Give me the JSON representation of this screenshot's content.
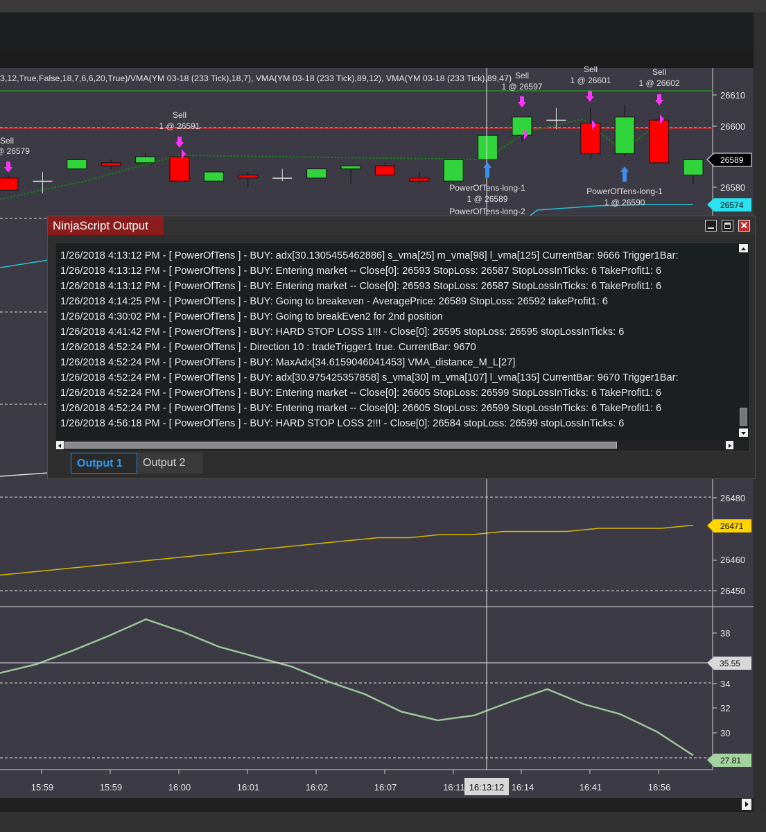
{
  "colors": {
    "chart_bg": "#3c3b45",
    "bull_candle": "#2fd53b",
    "bear_candle": "#ff0000",
    "sell_arrow": "#ff33ff",
    "buy_arrow": "#3b8ff0",
    "hline_red": "#cc2b2b",
    "hline_green": "#2a8a2a",
    "cyan": "#29c2d6",
    "gold": "#d9b800",
    "adx_line": "#9dc59a"
  },
  "chart_header": "3,12,True,False,18,7,6,6,20,True)/VMA(YM 03-18 (233 Tick),18,7), VMA(YM 03-18 (233 Tick),89,12), VMA(YM 03-18 (233 Tick),89,47)",
  "price_panel": {
    "ticks": [
      "26610",
      "26600",
      "26580"
    ],
    "last_price": "26589",
    "cyan_tag": "26574"
  },
  "vma_panel": {
    "ticks": [
      "26480",
      "26460",
      "26450"
    ],
    "gold_tag": "26471"
  },
  "adx_panel": {
    "ticks": [
      "38",
      "34",
      "32",
      "30"
    ],
    "crosshair_value": "35.55",
    "last_value": "27.81"
  },
  "time_axis": {
    "labels": [
      "15:59",
      "15:59",
      "16:00",
      "16:01",
      "16:02",
      "16:07",
      "16:11",
      "16:14",
      "16:41",
      "16:56"
    ],
    "crosshair_time": "16:13:12"
  },
  "annotations": [
    {
      "text": "Sell",
      "kind": "sell"
    },
    {
      "text": "@ 26579",
      "kind": "sell"
    },
    {
      "text": "Sell",
      "kind": "sell"
    },
    {
      "text": "1 @ 26591",
      "kind": "sell"
    },
    {
      "text": "Sell",
      "kind": "sell"
    },
    {
      "text": "1 @ 26597",
      "kind": "sell"
    },
    {
      "text": "Sell",
      "kind": "sell"
    },
    {
      "text": "1 @ 26601",
      "kind": "sell"
    },
    {
      "text": "Sell",
      "kind": "sell"
    },
    {
      "text": "1 @ 26602",
      "kind": "sell"
    },
    {
      "text": "PowerOfTens-long-1",
      "kind": "buy"
    },
    {
      "text": "1 @ 26589",
      "kind": "buy"
    },
    {
      "text": "PowerOfTens-long-2",
      "kind": "buy"
    },
    {
      "text": "PowerOfTens-long-1",
      "kind": "buy"
    },
    {
      "text": "1 @ 26590",
      "kind": "buy"
    }
  ],
  "chart_data": [
    {
      "type": "candlestick",
      "title": "",
      "ylim": [
        26570,
        26612
      ],
      "candles": [
        {
          "o": 26583,
          "h": 26584,
          "l": 26579,
          "c": 26579
        },
        {
          "o": 26582,
          "h": 26585,
          "l": 26578,
          "c": 26582
        },
        {
          "o": 26586,
          "h": 26589,
          "l": 26586,
          "c": 26589
        },
        {
          "o": 26588,
          "h": 26589,
          "l": 26586,
          "c": 26587
        },
        {
          "o": 26588,
          "h": 26591,
          "l": 26588,
          "c": 26590
        },
        {
          "o": 26590,
          "h": 26590,
          "l": 26582,
          "c": 26582
        },
        {
          "o": 26582,
          "h": 26585,
          "l": 26582,
          "c": 26585
        },
        {
          "o": 26584,
          "h": 26585,
          "l": 26580,
          "c": 26583
        },
        {
          "o": 26583,
          "h": 26586,
          "l": 26582,
          "c": 26583
        },
        {
          "o": 26583,
          "h": 26586,
          "l": 26583,
          "c": 26586
        },
        {
          "o": 26586,
          "h": 26587,
          "l": 26581,
          "c": 26587
        },
        {
          "o": 26587,
          "h": 26588,
          "l": 26584,
          "c": 26584
        },
        {
          "o": 26583,
          "h": 26585,
          "l": 26581,
          "c": 26582
        },
        {
          "o": 26582,
          "h": 26589,
          "l": 26581,
          "c": 26589
        },
        {
          "o": 26589,
          "h": 26597,
          "l": 26589,
          "c": 26597
        },
        {
          "o": 26597,
          "h": 26603,
          "l": 26595,
          "c": 26603
        },
        {
          "o": 26602,
          "h": 26606,
          "l": 26599,
          "c": 26602
        },
        {
          "o": 26601,
          "h": 26606,
          "l": 26589,
          "c": 26591
        },
        {
          "o": 26591,
          "h": 26607,
          "l": 26590,
          "c": 26603
        },
        {
          "o": 26602,
          "h": 26603,
          "l": 26588,
          "c": 26588
        },
        {
          "o": 26584,
          "h": 26589,
          "l": 26581,
          "c": 26589
        }
      ]
    },
    {
      "type": "line",
      "title": "",
      "series": [
        {
          "values": [
            26455,
            26456,
            26457,
            26458,
            26459,
            26460,
            26461,
            26462,
            26463,
            26464,
            26465,
            26466,
            26467,
            26467,
            26468,
            26468,
            26469,
            26469,
            26469,
            26470,
            26470,
            26470,
            26471
          ]
        }
      ]
    },
    {
      "type": "line",
      "title": "",
      "series": [
        {
          "values": [
            34.8,
            35.5,
            36.6,
            37.8,
            39.1,
            38.1,
            36.9,
            36.1,
            35.3,
            34.1,
            33.1,
            31.7,
            31.0,
            31.4,
            32.5,
            33.5,
            32.3,
            31.5,
            30.1,
            28.2
          ]
        }
      ]
    }
  ],
  "output_window": {
    "title": "NinjaScript Output",
    "lines": [
      "1/26/2018 4:13:12 PM - [ PowerOfTens ] - BUY: adx[30.1305455462886] s_vma[25] m_vma[98] l_vma[125] CurrentBar: 9666 Trigger1Bar:",
      "1/26/2018 4:13:12 PM - [ PowerOfTens ] - BUY: Entering market -- Close[0]: 26593 StopLoss: 26587 StopLossInTicks: 6 TakeProfit1: 6",
      "1/26/2018 4:13:12 PM - [ PowerOfTens ] - BUY: Entering market -- Close[0]: 26593 StopLoss: 26587 StopLossInTicks: 6 TakeProfit1: 6",
      "1/26/2018 4:14:25 PM - [ PowerOfTens ] - BUY: Going to breakeven - AveragePrice: 26589 StopLoss: 26592 takeProfit1: 6",
      "1/26/2018 4:30:02 PM - [ PowerOfTens ] - BUY: Going to breakEven2 for 2nd position",
      "1/26/2018 4:41:42 PM - [ PowerOfTens ] - BUY: HARD STOP LOSS 1!!! - Close[0]: 26595 stopLoss: 26595 stopLossInTicks: 6",
      "1/26/2018 4:52:24 PM - [ PowerOfTens ] - Direction 10 : tradeTrigger1 true. CurrentBar: 9670",
      "1/26/2018 4:52:24 PM - [ PowerOfTens ] - BUY: MaxAdx[34.6159046041453] VMA_distance_M_L[27]",
      "1/26/2018 4:52:24 PM - [ PowerOfTens ] - BUY: adx[30.975425357858] s_vma[30] m_vma[107] l_vma[135] CurrentBar: 9670 Trigger1Bar:",
      "1/26/2018 4:52:24 PM - [ PowerOfTens ] - BUY: Entering market -- Close[0]: 26605 StopLoss: 26599 StopLossInTicks: 6 TakeProfit1: 6",
      "1/26/2018 4:52:24 PM - [ PowerOfTens ] - BUY: Entering market -- Close[0]: 26605 StopLoss: 26599 StopLossInTicks: 6 TakeProfit1: 6",
      "1/26/2018 4:56:18 PM - [ PowerOfTens ] - BUY: HARD STOP LOSS 2!!! - Close[0]: 26584 stopLoss: 26599 stopLossInTicks: 6"
    ],
    "tabs": [
      "Output 1",
      "Output 2"
    ],
    "close_glyph": "✕"
  }
}
